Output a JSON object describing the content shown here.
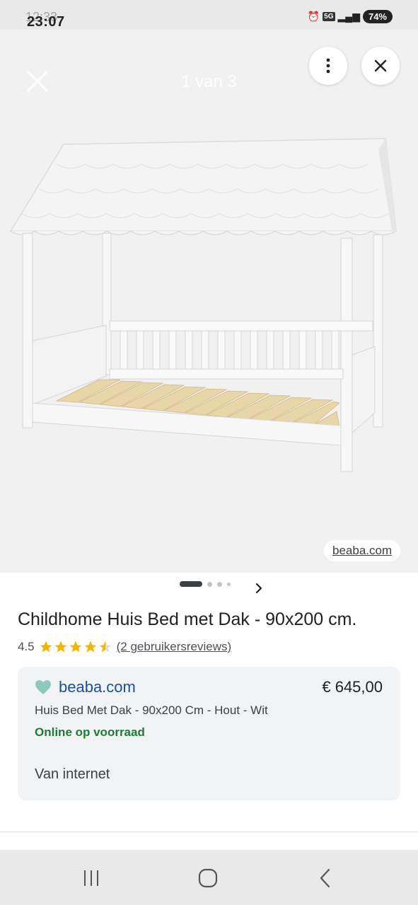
{
  "status_bar": {
    "time": "23:07",
    "time_ghost": "12:33",
    "network": "5G",
    "battery": "74%"
  },
  "viewer": {
    "counter": "1 van 3",
    "source_label": "beaba.com"
  },
  "product": {
    "title": "Childhome Huis Bed met Dak - 90x200 cm.",
    "rating": "4.5",
    "rating_value": 4.5,
    "rating_max": 5,
    "reviews_link": "(2 gebruikersreviews)"
  },
  "offer": {
    "merchant": "beaba.com",
    "price": "€ 645,00",
    "description": "Huis Bed Met Dak - 90x200 Cm - Hout - Wit",
    "stock": "Online op voorraad",
    "source_note": "Van internet"
  },
  "carousel": {
    "current": 1,
    "total": 4
  },
  "colors": {
    "merchant": "#1a4f9c",
    "stock": "#1e7b34",
    "star": "#f4b400",
    "merchant_heart": "#8ec9c0"
  }
}
